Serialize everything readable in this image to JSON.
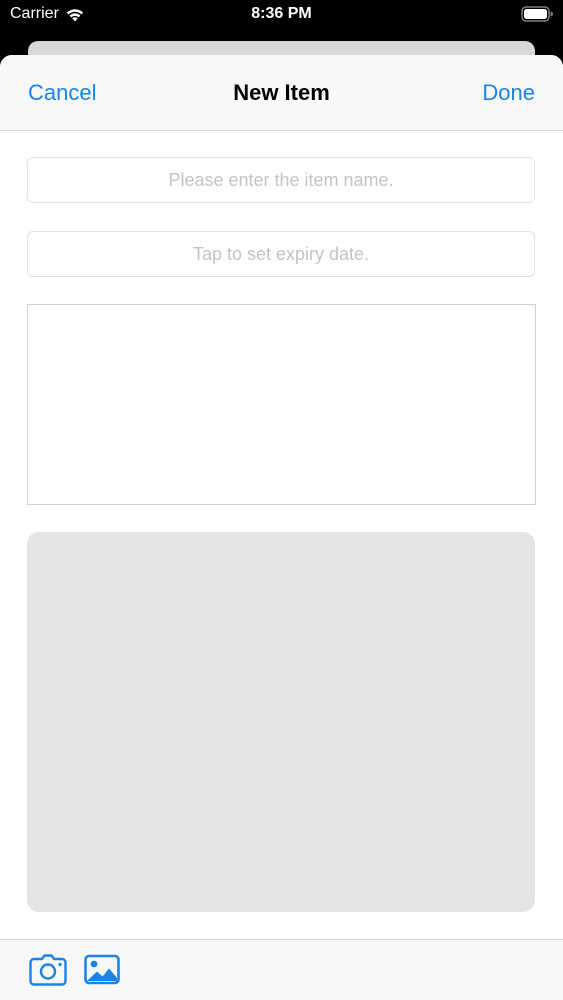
{
  "status_bar": {
    "carrier": "Carrier",
    "time": "8:36 PM",
    "wifi_icon": "wifi-icon",
    "battery_icon": "battery-icon"
  },
  "nav": {
    "cancel_label": "Cancel",
    "title": "New Item",
    "done_label": "Done"
  },
  "form": {
    "name_placeholder": "Please enter the item name.",
    "name_value": "",
    "date_placeholder": "Tap to set expiry date.",
    "date_value": "",
    "notes_value": ""
  },
  "toolbar": {
    "camera_icon": "camera-icon",
    "photo_icon": "photo-library-icon"
  },
  "colors": {
    "accent": "#1a82e8",
    "nav_background": "#f8f8f8",
    "image_placeholder": "#e4e4e6",
    "placeholder_text": "#c4c4c8"
  }
}
